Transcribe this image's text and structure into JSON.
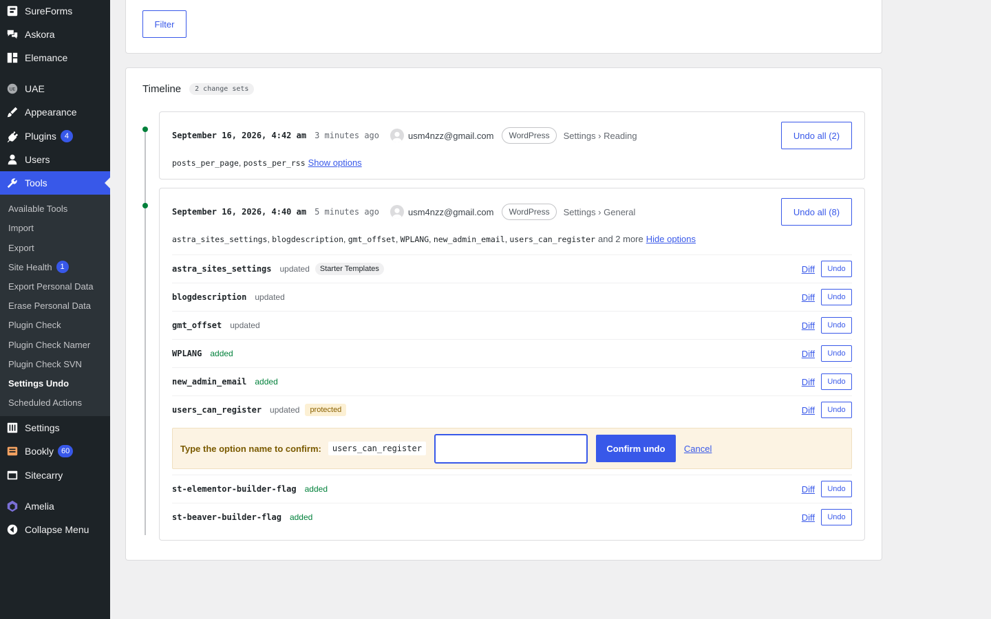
{
  "sidebar": {
    "top_items": [
      {
        "label": "SureForms",
        "icon": "sureforms-icon"
      },
      {
        "label": "Askora",
        "icon": "chat-bubbles-icon"
      },
      {
        "label": "Elemance",
        "icon": "grid-icon"
      },
      {
        "label": "UAE",
        "icon": "uae-icon"
      },
      {
        "label": "Appearance",
        "icon": "paintbrush-icon"
      },
      {
        "label": "Plugins",
        "icon": "plug-icon",
        "badge": "4"
      },
      {
        "label": "Users",
        "icon": "user-icon"
      },
      {
        "label": "Tools",
        "icon": "wrench-icon"
      }
    ],
    "submenu": [
      {
        "label": "Available Tools"
      },
      {
        "label": "Import"
      },
      {
        "label": "Export"
      },
      {
        "label": "Site Health",
        "badge": "1"
      },
      {
        "label": "Export Personal Data"
      },
      {
        "label": "Erase Personal Data"
      },
      {
        "label": "Plugin Check"
      },
      {
        "label": "Plugin Check Namer"
      },
      {
        "label": "Plugin Check SVN"
      },
      {
        "label": "Settings Undo"
      },
      {
        "label": "Scheduled Actions"
      }
    ],
    "bottom_items": [
      {
        "label": "Settings",
        "icon": "settings-icon"
      },
      {
        "label": "Bookly",
        "icon": "bookly-icon",
        "badge": "60"
      },
      {
        "label": "Sitecarry",
        "icon": "sitecarry-icon"
      },
      {
        "label": "Amelia",
        "icon": "amelia-icon"
      },
      {
        "label": "Collapse Menu",
        "icon": "collapse-icon"
      }
    ]
  },
  "filter": {
    "button_label": "Filter"
  },
  "timeline": {
    "title": "Timeline",
    "count_label": "2 change sets",
    "sets": [
      {
        "date": "September 16, 2026, 4:42 am",
        "ago": "3 minutes ago",
        "user": "usm4nzz@gmail.com",
        "source": "WordPress",
        "crumb": "Settings › Reading",
        "undo_all_label": "Undo all (2)",
        "options": [
          "posts_per_page",
          "posts_per_rss"
        ],
        "toggle_label": "Show options"
      },
      {
        "date": "September 16, 2026, 4:40 am",
        "ago": "5 minutes ago",
        "user": "usm4nzz@gmail.com",
        "source": "WordPress",
        "crumb": "Settings › General",
        "undo_all_label": "Undo all (8)",
        "options": [
          "astra_sites_settings",
          "blogdescription",
          "gmt_offset",
          "WPLANG",
          "new_admin_email",
          "users_can_register"
        ],
        "more_label": "and 2 more",
        "toggle_label": "Hide options",
        "rows": [
          {
            "name": "astra_sites_settings",
            "status": "updated",
            "tag": "Starter Templates"
          },
          {
            "name": "blogdescription",
            "status": "updated"
          },
          {
            "name": "gmt_offset",
            "status": "updated"
          },
          {
            "name": "WPLANG",
            "status": "added"
          },
          {
            "name": "new_admin_email",
            "status": "added"
          },
          {
            "name": "users_can_register",
            "status": "updated",
            "tag": "protected"
          },
          {
            "name": "st-elementor-builder-flag",
            "status": "added"
          },
          {
            "name": "st-beaver-builder-flag",
            "status": "added"
          }
        ],
        "diff_label": "Diff",
        "undo_label": "Undo",
        "confirm": {
          "label": "Type the option name to confirm:",
          "code": "users_can_register",
          "input_value": "",
          "button_label": "Confirm undo",
          "cancel_label": "Cancel"
        }
      }
    ]
  },
  "colors": {
    "accent": "#3858e9",
    "sidebar_bg": "#1d2327",
    "added": "#00803a",
    "confirm_bg": "#fcf3e3"
  }
}
